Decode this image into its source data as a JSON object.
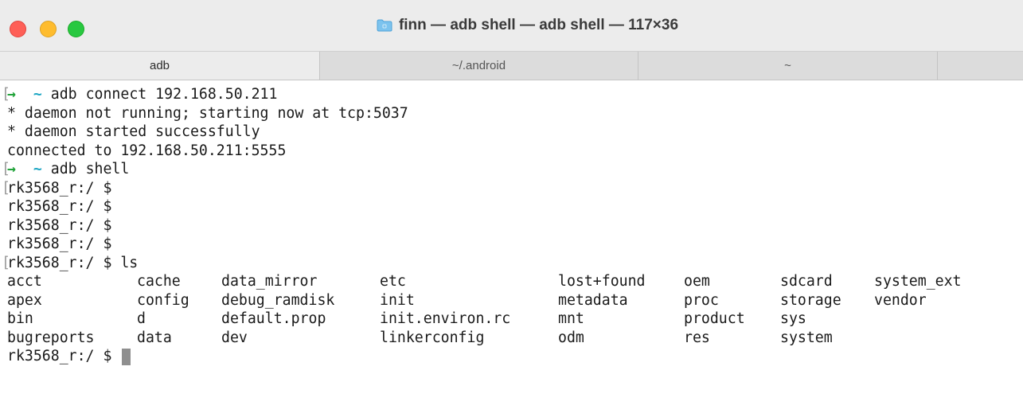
{
  "window": {
    "title": "finn — adb shell — adb shell — 117×36"
  },
  "tabs": [
    {
      "label": "adb",
      "active": true
    },
    {
      "label": "~/.android",
      "active": false
    },
    {
      "label": "~",
      "active": false
    }
  ],
  "terminal": {
    "prompt_arrow": "→",
    "prompt_tilde": "~",
    "cmd1": "adb connect 192.168.50.211",
    "out1": "* daemon not running; starting now at tcp:5037",
    "out2": "* daemon started successfully",
    "out3": "connected to 192.168.50.211:5555",
    "cmd2": "adb shell",
    "device_prompts": [
      "rk3568_r:/ $",
      "rk3568_r:/ $",
      "rk3568_r:/ $",
      "rk3568_r:/ $"
    ],
    "ls_line": "rk3568_r:/ $ ls",
    "ls_rows": [
      [
        "acct",
        "cache",
        "data_mirror",
        "etc",
        "lost+found",
        "oem",
        "sdcard",
        "system_ext"
      ],
      [
        "apex",
        "config",
        "debug_ramdisk",
        "init",
        "metadata",
        "proc",
        "storage",
        "vendor"
      ],
      [
        "bin",
        "d",
        "default.prop",
        "init.environ.rc",
        "mnt",
        "product",
        "sys",
        ""
      ],
      [
        "bugreports",
        "data",
        "dev",
        "linkerconfig",
        "odm",
        "res",
        "system",
        ""
      ]
    ],
    "final_prompt": "rk3568_r:/ $"
  },
  "colors": {
    "prompt_arrow": "#22a33a",
    "prompt_tilde": "#1fa7c4",
    "close": "#fe5f57",
    "minimize": "#febc2e",
    "maximize": "#28c840"
  }
}
